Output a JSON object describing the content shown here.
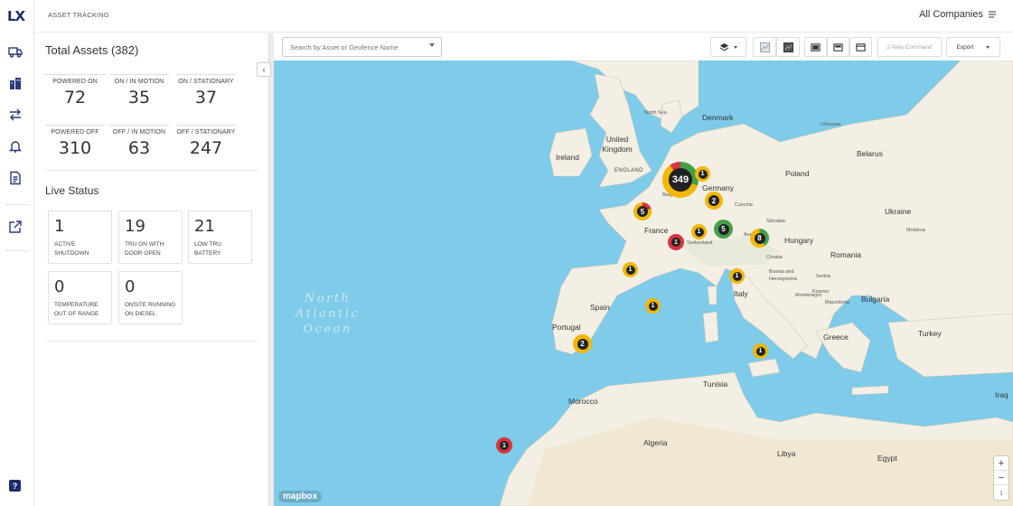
{
  "app": {
    "logo": "LX",
    "section": "ASSET TRACKING",
    "company": "All Companies"
  },
  "rail": {
    "icons": [
      "truck-icon",
      "buildings-icon",
      "transfer-arrows-icon",
      "bell-icon",
      "document-icon",
      "external-link-icon"
    ],
    "help": "?"
  },
  "totals": {
    "title": "Total Assets (382)",
    "stats": [
      {
        "label": "POWERED ON",
        "value": "72"
      },
      {
        "label": "ON / IN MOTION",
        "value": "35"
      },
      {
        "label": "ON / STATIONARY",
        "value": "37"
      },
      {
        "label": "POWERED OFF",
        "value": "310"
      },
      {
        "label": "OFF / IN MOTION",
        "value": "63"
      },
      {
        "label": "OFF / STATIONARY",
        "value": "247"
      }
    ]
  },
  "live": {
    "title": "Live Status",
    "cards": [
      {
        "value": "1",
        "label": "ACTIVE SHUTDOWN"
      },
      {
        "value": "19",
        "label": "TRU ON WITH DOOR OPEN"
      },
      {
        "value": "21",
        "label": "LOW TRU BATTERY"
      },
      {
        "value": "0",
        "label": "TEMPERATURE OUT OF RANGE"
      },
      {
        "value": "0",
        "label": "ONSITE RUNNING ON DIESEL"
      }
    ]
  },
  "toolbar": {
    "search_placeholder": "Search by Asset or Geofence Name",
    "command_label": "2-Way Command",
    "export_label": "Export"
  },
  "map": {
    "ocean": [
      "North",
      "Atlantic",
      "Ocean"
    ],
    "attribution": "mapbox",
    "colors": {
      "water": "#7ecbea",
      "land": "#f3efe4",
      "cluster_yellow": "#f2b705",
      "cluster_red": "#d9333f",
      "cluster_green": "#43a047",
      "cluster_core": "#222222"
    },
    "labels": {
      "north_sea": "North Sea",
      "denmark": "Denmark",
      "lithuania": "Lithuania",
      "belarus": "Belarus",
      "united_kingdom": "United Kingdom",
      "ireland": "Ireland",
      "england": "ENGLAND",
      "poland": "Poland",
      "germany": "Germany",
      "belgium": "Belgium",
      "czechia": "Czechia",
      "slovakia": "Slovakia",
      "ukraine": "Ukraine",
      "moldova": "Moldova",
      "france": "France",
      "austria": "Austria",
      "hungary": "Hungary",
      "switzerland": "Switzerland",
      "romania": "Romania",
      "croatia": "Croatia",
      "bosnia": "Bosnia and Herzegovina",
      "serbia": "Serbia",
      "bulgaria": "Bulgaria",
      "italy": "Italy",
      "spain": "Spain",
      "portugal": "Portugal",
      "greece": "Greece",
      "turkey": "Turkey",
      "tunisia": "Tunisia",
      "morocco": "Morocco",
      "algeria": "Algeria",
      "libya": "Libya",
      "egypt": "Egypt",
      "iraq": "Iraq",
      "kosovo": "Kosovo",
      "macedonia": "Macedonia",
      "montenegro": "Montenegro"
    },
    "clusters": [
      {
        "count": "349",
        "ring": "mixed"
      },
      {
        "count": "1",
        "ring": "yellow"
      },
      {
        "count": "2",
        "ring": "yellow"
      },
      {
        "count": "5",
        "ring": "mixed"
      },
      {
        "count": "1",
        "ring": "red"
      },
      {
        "count": "1",
        "ring": "yellow"
      },
      {
        "count": "5",
        "ring": "green"
      },
      {
        "count": "8",
        "ring": "mixed"
      },
      {
        "count": "1",
        "ring": "yellow"
      },
      {
        "count": "1",
        "ring": "yellow"
      },
      {
        "count": "1",
        "ring": "yellow"
      },
      {
        "count": "2",
        "ring": "yellow"
      },
      {
        "count": "1",
        "ring": "yellow"
      },
      {
        "count": "1",
        "ring": "red"
      }
    ],
    "zoom": {
      "in": "+",
      "out": "−",
      "reset": "↕"
    }
  }
}
